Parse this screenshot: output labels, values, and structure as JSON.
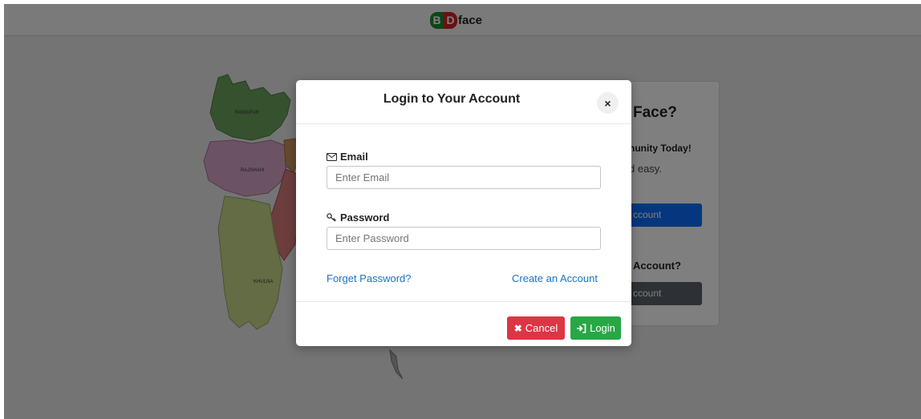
{
  "brand": {
    "letter_b": "B",
    "letter_d": "D",
    "name": "face"
  },
  "map": {
    "regions": [
      "RANGPUR",
      "RAJSHAHI",
      "KHULNA"
    ]
  },
  "background_card": {
    "title_fragment": "Face?",
    "tagline_fragment": "nunity Today!",
    "subtitle_fragment": "d easy.",
    "create_button_fragment": "ccount",
    "question_fragment": "Account?",
    "login_button_fragment": "ccount"
  },
  "modal": {
    "title": "Login to Your Account",
    "close_glyph": "×",
    "email": {
      "label": "Email",
      "placeholder": "Enter Email",
      "value": ""
    },
    "password": {
      "label": "Password",
      "placeholder": "Enter Password",
      "value": ""
    },
    "forget_link": "Forget Password?",
    "create_link": "Create an Account",
    "cancel_label": "Cancel",
    "login_label": "Login"
  },
  "colors": {
    "overlay": "rgba(0,0,0,0.5)",
    "cancel": "#dc3545",
    "login": "#28a745",
    "link": "#1a73c8",
    "brand_green": "#1f8a2e",
    "brand_red": "#d42027"
  },
  "icons": {
    "email": "envelope-icon",
    "password": "key-icon",
    "cancel": "x-icon",
    "login": "sign-in-icon",
    "close": "close-icon"
  }
}
